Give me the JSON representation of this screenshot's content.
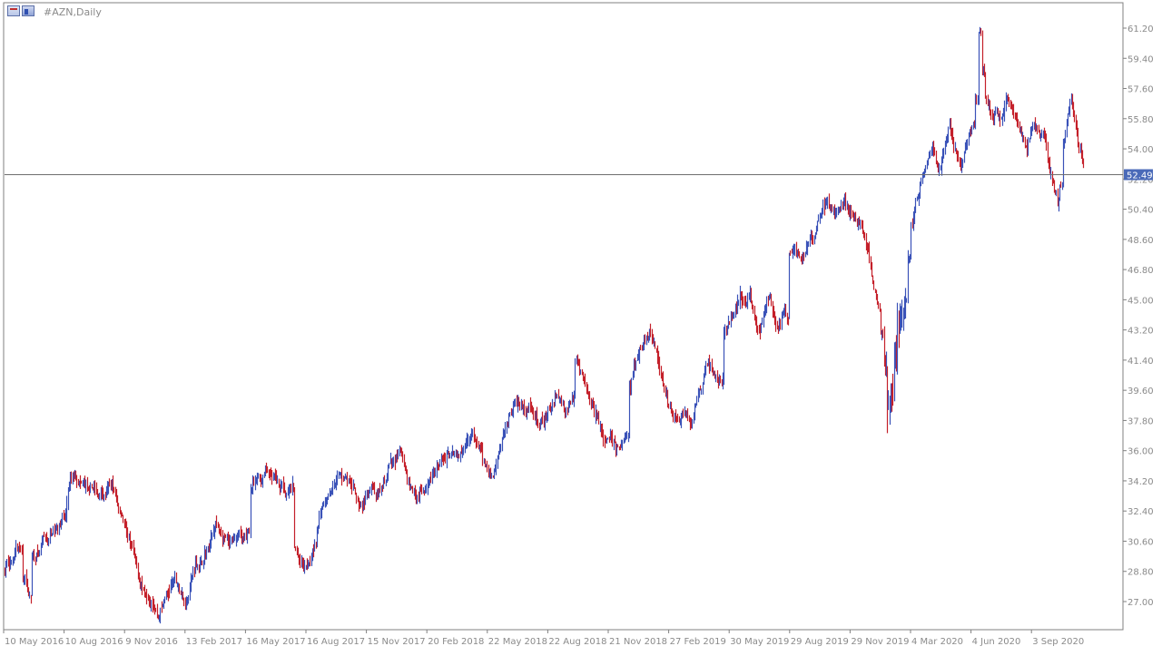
{
  "window": {
    "symbol_timeframe": "#AZN,Daily"
  },
  "colors": {
    "background": "#ffffff",
    "axis": "#808080",
    "bull": "#3a52b8",
    "bear": "#c4202a",
    "current_price_line": "#6f6f6f",
    "price_tag_bg": "#4a6ab8"
  },
  "chart_data": {
    "type": "candlestick",
    "title": "#AZN,Daily",
    "xlabel": "",
    "ylabel": "",
    "ylim": [
      25.8,
      62.6
    ],
    "y_ticks": [
      "61.20",
      "59.40",
      "57.60",
      "55.80",
      "54.00",
      "52.20",
      "50.40",
      "48.60",
      "46.80",
      "45.00",
      "43.20",
      "41.40",
      "39.60",
      "37.80",
      "36.00",
      "34.20",
      "32.40",
      "30.60",
      "28.80",
      "27.00"
    ],
    "x_ticks": [
      "10 May 2016",
      "10 Aug 2016",
      "9 Nov 2016",
      "13 Feb 2017",
      "16 May 2017",
      "16 Aug 2017",
      "15 Nov 2017",
      "20 Feb 2018",
      "22 May 2018",
      "22 Aug 2018",
      "21 Nov 2018",
      "27 Feb 2019",
      "30 May 2019",
      "29 Aug 2019",
      "29 Nov 2019",
      "4 Mar 2020",
      "4 Jun 2020",
      "3 Sep 2020"
    ],
    "current_price": 52.49,
    "current_price_label": "52.49",
    "grid": false,
    "series": [
      {
        "values": [
          [
            0,
            28.8
          ],
          [
            3,
            29.5
          ],
          [
            6,
            29.2
          ],
          [
            10,
            30.3
          ],
          [
            14,
            30.0
          ],
          [
            18,
            28.4
          ],
          [
            22,
            27.3
          ],
          [
            26,
            29.8
          ],
          [
            30,
            29.6
          ],
          [
            34,
            30.8
          ],
          [
            38,
            30.6
          ],
          [
            42,
            31.2
          ],
          [
            46,
            31.3
          ],
          [
            50,
            31.9
          ],
          [
            54,
            32.1
          ],
          [
            56,
            33.6
          ],
          [
            58,
            34.2
          ],
          [
            62,
            34.6
          ],
          [
            66,
            34.0
          ],
          [
            70,
            34.1
          ],
          [
            74,
            33.6
          ],
          [
            78,
            33.9
          ],
          [
            82,
            33.3
          ],
          [
            86,
            33.5
          ],
          [
            88,
            33.1
          ],
          [
            92,
            33.9
          ],
          [
            95,
            34.0
          ],
          [
            98,
            33.3
          ],
          [
            101,
            32.6
          ],
          [
            104,
            32.2
          ],
          [
            108,
            31.0
          ],
          [
            112,
            30.4
          ],
          [
            115,
            29.6
          ],
          [
            118,
            28.8
          ],
          [
            120,
            28.1
          ],
          [
            124,
            27.6
          ],
          [
            128,
            27.2
          ],
          [
            131,
            26.9
          ],
          [
            134,
            26.4
          ],
          [
            136,
            26.1
          ],
          [
            139,
            26.6
          ],
          [
            142,
            27.3
          ],
          [
            145,
            27.5
          ],
          [
            148,
            28.1
          ],
          [
            151,
            28.3
          ],
          [
            154,
            28.0
          ],
          [
            157,
            27.3
          ],
          [
            160,
            26.8
          ],
          [
            163,
            27.5
          ],
          [
            166,
            28.5
          ],
          [
            169,
            29.4
          ],
          [
            172,
            29.1
          ],
          [
            175,
            29.5
          ],
          [
            178,
            29.9
          ],
          [
            181,
            30.2
          ],
          [
            184,
            31.0
          ],
          [
            187,
            31.6
          ],
          [
            190,
            31.4
          ],
          [
            193,
            30.6
          ],
          [
            196,
            30.8
          ],
          [
            199,
            30.4
          ],
          [
            202,
            30.7
          ],
          [
            205,
            30.9
          ],
          [
            208,
            31.0
          ],
          [
            211,
            30.6
          ],
          [
            214,
            30.9
          ],
          [
            216,
            31.3
          ],
          [
            219,
            33.8
          ],
          [
            222,
            34.1
          ],
          [
            225,
            34.5
          ],
          [
            228,
            34.2
          ],
          [
            231,
            34.9
          ],
          [
            234,
            34.8
          ],
          [
            237,
            34.3
          ],
          [
            240,
            34.5
          ],
          [
            243,
            33.8
          ],
          [
            246,
            34.1
          ],
          [
            249,
            33.2
          ],
          [
            252,
            33.6
          ],
          [
            255,
            33.9
          ],
          [
            258,
            30.1
          ],
          [
            261,
            29.5
          ],
          [
            264,
            29.3
          ],
          [
            267,
            29.2
          ],
          [
            270,
            29.4
          ],
          [
            273,
            29.9
          ],
          [
            276,
            30.6
          ],
          [
            279,
            32.1
          ],
          [
            282,
            32.8
          ],
          [
            285,
            33.2
          ],
          [
            288,
            33.5
          ],
          [
            291,
            33.9
          ],
          [
            294,
            34.3
          ],
          [
            297,
            34.6
          ],
          [
            300,
            34.4
          ],
          [
            303,
            34.3
          ],
          [
            306,
            34.0
          ],
          [
            309,
            33.8
          ],
          [
            312,
            33.1
          ],
          [
            315,
            32.7
          ],
          [
            318,
            32.9
          ],
          [
            321,
            33.3
          ],
          [
            324,
            33.6
          ],
          [
            327,
            33.7
          ],
          [
            330,
            33.2
          ],
          [
            333,
            33.4
          ],
          [
            336,
            34.0
          ],
          [
            339,
            34.6
          ],
          [
            342,
            35.3
          ],
          [
            345,
            35.2
          ],
          [
            348,
            35.8
          ],
          [
            351,
            36.0
          ],
          [
            354,
            35.0
          ],
          [
            357,
            34.3
          ],
          [
            360,
            33.8
          ],
          [
            363,
            33.5
          ],
          [
            366,
            33.3
          ],
          [
            369,
            33.6
          ],
          [
            372,
            33.4
          ],
          [
            375,
            33.9
          ],
          [
            378,
            34.3
          ],
          [
            381,
            34.8
          ],
          [
            384,
            35.1
          ],
          [
            387,
            35.6
          ],
          [
            390,
            35.4
          ],
          [
            393,
            35.8
          ],
          [
            396,
            36.0
          ],
          [
            399,
            35.8
          ],
          [
            402,
            35.6
          ],
          [
            405,
            36.1
          ],
          [
            408,
            36.4
          ],
          [
            411,
            36.8
          ],
          [
            414,
            37.0
          ],
          [
            417,
            36.5
          ],
          [
            420,
            36.3
          ],
          [
            423,
            35.8
          ],
          [
            426,
            35.2
          ],
          [
            429,
            34.7
          ],
          [
            432,
            34.4
          ],
          [
            435,
            35.0
          ],
          [
            438,
            35.8
          ],
          [
            441,
            36.8
          ],
          [
            444,
            37.4
          ],
          [
            447,
            38.0
          ],
          [
            450,
            38.4
          ],
          [
            453,
            38.9
          ],
          [
            456,
            39.0
          ],
          [
            459,
            38.5
          ],
          [
            462,
            38.2
          ],
          [
            465,
            38.6
          ],
          [
            468,
            38.2
          ],
          [
            471,
            37.9
          ],
          [
            474,
            37.5
          ],
          [
            477,
            37.8
          ],
          [
            480,
            38.0
          ],
          [
            483,
            38.3
          ],
          [
            486,
            38.8
          ],
          [
            489,
            39.5
          ],
          [
            492,
            39.0
          ],
          [
            495,
            38.7
          ],
          [
            498,
            38.3
          ],
          [
            501,
            38.7
          ],
          [
            504,
            39.3
          ],
          [
            507,
            41.5
          ],
          [
            510,
            41.0
          ],
          [
            513,
            40.3
          ],
          [
            516,
            39.6
          ],
          [
            519,
            39.1
          ],
          [
            522,
            38.6
          ],
          [
            525,
            38.1
          ],
          [
            528,
            37.4
          ],
          [
            531,
            36.8
          ],
          [
            534,
            36.5
          ],
          [
            537,
            37.0
          ],
          [
            540,
            36.4
          ],
          [
            543,
            36.1
          ],
          [
            546,
            36.3
          ],
          [
            549,
            36.7
          ],
          [
            552,
            36.9
          ],
          [
            555,
            39.8
          ],
          [
            558,
            40.9
          ],
          [
            561,
            41.6
          ],
          [
            564,
            42.1
          ],
          [
            567,
            42.6
          ],
          [
            570,
            42.9
          ],
          [
            573,
            43.0
          ],
          [
            576,
            42.5
          ],
          [
            579,
            41.4
          ],
          [
            582,
            40.6
          ],
          [
            585,
            39.7
          ],
          [
            588,
            39.0
          ],
          [
            591,
            38.4
          ],
          [
            594,
            37.9
          ],
          [
            597,
            37.7
          ],
          [
            600,
            38.1
          ],
          [
            603,
            38.4
          ],
          [
            606,
            37.9
          ],
          [
            609,
            37.6
          ],
          [
            612,
            38.6
          ],
          [
            615,
            39.4
          ],
          [
            618,
            39.6
          ],
          [
            621,
            40.8
          ],
          [
            624,
            41.3
          ],
          [
            627,
            41.0
          ],
          [
            630,
            40.4
          ],
          [
            633,
            40.1
          ],
          [
            636,
            40.2
          ],
          [
            640,
            43.2
          ],
          [
            643,
            43.8
          ],
          [
            646,
            44.3
          ],
          [
            649,
            44.6
          ],
          [
            652,
            45.3
          ],
          [
            655,
            45.0
          ],
          [
            658,
            44.6
          ],
          [
            661,
            45.5
          ],
          [
            664,
            44.4
          ],
          [
            667,
            43.3
          ],
          [
            670,
            43.1
          ],
          [
            673,
            44.0
          ],
          [
            676,
            44.9
          ],
          [
            679,
            45.2
          ],
          [
            682,
            43.9
          ],
          [
            685,
            43.2
          ],
          [
            688,
            43.6
          ],
          [
            691,
            44.3
          ],
          [
            694,
            44.0
          ],
          [
            697,
            47.6
          ],
          [
            700,
            48.2
          ],
          [
            703,
            47.8
          ],
          [
            706,
            47.4
          ],
          [
            709,
            47.6
          ],
          [
            712,
            48.3
          ],
          [
            715,
            48.8
          ],
          [
            718,
            48.6
          ],
          [
            721,
            49.5
          ],
          [
            724,
            50.2
          ],
          [
            727,
            50.6
          ],
          [
            730,
            50.9
          ],
          [
            733,
            50.4
          ],
          [
            736,
            50.1
          ],
          [
            739,
            50.3
          ],
          [
            742,
            50.6
          ],
          [
            745,
            50.9
          ],
          [
            748,
            50.5
          ],
          [
            751,
            50.1
          ],
          [
            754,
            49.9
          ],
          [
            757,
            49.6
          ],
          [
            760,
            49.2
          ],
          [
            763,
            48.6
          ],
          [
            766,
            47.8
          ],
          [
            769,
            46.5
          ],
          [
            772,
            45.3
          ],
          [
            775,
            44.6
          ],
          [
            778,
            43.0
          ],
          [
            781,
            41.0
          ],
          [
            784,
            38.6
          ],
          [
            787,
            39.4
          ],
          [
            790,
            41.6
          ],
          [
            793,
            43.4
          ],
          [
            796,
            44.4
          ],
          [
            799,
            45.0
          ],
          [
            802,
            47.5
          ],
          [
            805,
            49.6
          ],
          [
            808,
            50.8
          ],
          [
            811,
            51.4
          ],
          [
            814,
            52.4
          ],
          [
            817,
            53.1
          ],
          [
            820,
            53.8
          ],
          [
            823,
            54.0
          ],
          [
            826,
            53.4
          ],
          [
            829,
            52.8
          ],
          [
            832,
            53.7
          ],
          [
            835,
            54.5
          ],
          [
            838,
            55.4
          ],
          [
            841,
            54.6
          ],
          [
            844,
            53.6
          ],
          [
            847,
            53.0
          ],
          [
            850,
            53.4
          ],
          [
            853,
            54.3
          ],
          [
            856,
            54.8
          ],
          [
            859,
            55.3
          ],
          [
            862,
            57.0
          ],
          [
            865,
            60.8
          ],
          [
            868,
            58.6
          ],
          [
            871,
            57.0
          ],
          [
            874,
            56.3
          ],
          [
            877,
            55.8
          ],
          [
            880,
            56.4
          ],
          [
            883,
            55.6
          ],
          [
            886,
            56.2
          ],
          [
            889,
            57.1
          ],
          [
            892,
            56.6
          ],
          [
            895,
            56.0
          ],
          [
            898,
            55.4
          ],
          [
            901,
            55.0
          ],
          [
            904,
            54.4
          ],
          [
            907,
            53.9
          ],
          [
            910,
            54.8
          ],
          [
            913,
            55.6
          ],
          [
            916,
            55.1
          ],
          [
            919,
            54.6
          ],
          [
            922,
            54.9
          ],
          [
            925,
            53.6
          ],
          [
            928,
            52.4
          ],
          [
            931,
            51.6
          ],
          [
            934,
            50.9
          ],
          [
            937,
            51.8
          ],
          [
            940,
            54.5
          ],
          [
            943,
            56.0
          ],
          [
            946,
            57.0
          ],
          [
            949,
            55.6
          ],
          [
            952,
            54.4
          ],
          [
            955,
            53.8
          ],
          [
            957,
            53.0
          ]
        ]
      }
    ]
  }
}
